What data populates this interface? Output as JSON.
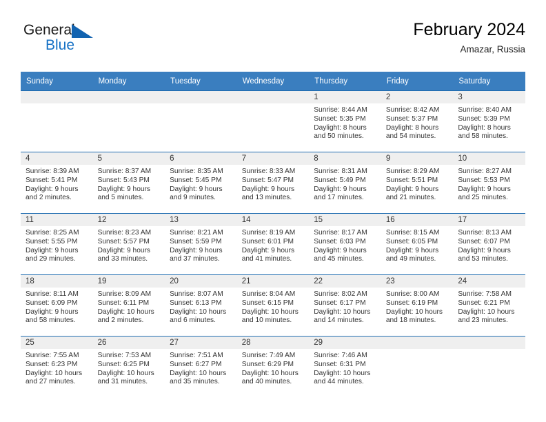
{
  "brand": {
    "word1": "General",
    "word2": "Blue",
    "accent_color": "#1671c5",
    "triangle_icon": "triangle-logo-icon"
  },
  "header": {
    "title": "February 2024",
    "subtitle": "Amazar, Russia"
  },
  "theme": {
    "header_row_bg": "#3a7ebf",
    "row_divider": "#1e6bb0",
    "daynum_band_bg": "#efefef",
    "text": "#333333"
  },
  "weekday_headers": [
    "Sunday",
    "Monday",
    "Tuesday",
    "Wednesday",
    "Thursday",
    "Friday",
    "Saturday"
  ],
  "weeks": [
    [
      {
        "day": "",
        "lines": []
      },
      {
        "day": "",
        "lines": []
      },
      {
        "day": "",
        "lines": []
      },
      {
        "day": "",
        "lines": []
      },
      {
        "day": "1",
        "lines": [
          "Sunrise: 8:44 AM",
          "Sunset: 5:35 PM",
          "Daylight: 8 hours",
          "and 50 minutes."
        ]
      },
      {
        "day": "2",
        "lines": [
          "Sunrise: 8:42 AM",
          "Sunset: 5:37 PM",
          "Daylight: 8 hours",
          "and 54 minutes."
        ]
      },
      {
        "day": "3",
        "lines": [
          "Sunrise: 8:40 AM",
          "Sunset: 5:39 PM",
          "Daylight: 8 hours",
          "and 58 minutes."
        ]
      }
    ],
    [
      {
        "day": "4",
        "lines": [
          "Sunrise: 8:39 AM",
          "Sunset: 5:41 PM",
          "Daylight: 9 hours",
          "and 2 minutes."
        ]
      },
      {
        "day": "5",
        "lines": [
          "Sunrise: 8:37 AM",
          "Sunset: 5:43 PM",
          "Daylight: 9 hours",
          "and 5 minutes."
        ]
      },
      {
        "day": "6",
        "lines": [
          "Sunrise: 8:35 AM",
          "Sunset: 5:45 PM",
          "Daylight: 9 hours",
          "and 9 minutes."
        ]
      },
      {
        "day": "7",
        "lines": [
          "Sunrise: 8:33 AM",
          "Sunset: 5:47 PM",
          "Daylight: 9 hours",
          "and 13 minutes."
        ]
      },
      {
        "day": "8",
        "lines": [
          "Sunrise: 8:31 AM",
          "Sunset: 5:49 PM",
          "Daylight: 9 hours",
          "and 17 minutes."
        ]
      },
      {
        "day": "9",
        "lines": [
          "Sunrise: 8:29 AM",
          "Sunset: 5:51 PM",
          "Daylight: 9 hours",
          "and 21 minutes."
        ]
      },
      {
        "day": "10",
        "lines": [
          "Sunrise: 8:27 AM",
          "Sunset: 5:53 PM",
          "Daylight: 9 hours",
          "and 25 minutes."
        ]
      }
    ],
    [
      {
        "day": "11",
        "lines": [
          "Sunrise: 8:25 AM",
          "Sunset: 5:55 PM",
          "Daylight: 9 hours",
          "and 29 minutes."
        ]
      },
      {
        "day": "12",
        "lines": [
          "Sunrise: 8:23 AM",
          "Sunset: 5:57 PM",
          "Daylight: 9 hours",
          "and 33 minutes."
        ]
      },
      {
        "day": "13",
        "lines": [
          "Sunrise: 8:21 AM",
          "Sunset: 5:59 PM",
          "Daylight: 9 hours",
          "and 37 minutes."
        ]
      },
      {
        "day": "14",
        "lines": [
          "Sunrise: 8:19 AM",
          "Sunset: 6:01 PM",
          "Daylight: 9 hours",
          "and 41 minutes."
        ]
      },
      {
        "day": "15",
        "lines": [
          "Sunrise: 8:17 AM",
          "Sunset: 6:03 PM",
          "Daylight: 9 hours",
          "and 45 minutes."
        ]
      },
      {
        "day": "16",
        "lines": [
          "Sunrise: 8:15 AM",
          "Sunset: 6:05 PM",
          "Daylight: 9 hours",
          "and 49 minutes."
        ]
      },
      {
        "day": "17",
        "lines": [
          "Sunrise: 8:13 AM",
          "Sunset: 6:07 PM",
          "Daylight: 9 hours",
          "and 53 minutes."
        ]
      }
    ],
    [
      {
        "day": "18",
        "lines": [
          "Sunrise: 8:11 AM",
          "Sunset: 6:09 PM",
          "Daylight: 9 hours",
          "and 58 minutes."
        ]
      },
      {
        "day": "19",
        "lines": [
          "Sunrise: 8:09 AM",
          "Sunset: 6:11 PM",
          "Daylight: 10 hours",
          "and 2 minutes."
        ]
      },
      {
        "day": "20",
        "lines": [
          "Sunrise: 8:07 AM",
          "Sunset: 6:13 PM",
          "Daylight: 10 hours",
          "and 6 minutes."
        ]
      },
      {
        "day": "21",
        "lines": [
          "Sunrise: 8:04 AM",
          "Sunset: 6:15 PM",
          "Daylight: 10 hours",
          "and 10 minutes."
        ]
      },
      {
        "day": "22",
        "lines": [
          "Sunrise: 8:02 AM",
          "Sunset: 6:17 PM",
          "Daylight: 10 hours",
          "and 14 minutes."
        ]
      },
      {
        "day": "23",
        "lines": [
          "Sunrise: 8:00 AM",
          "Sunset: 6:19 PM",
          "Daylight: 10 hours",
          "and 18 minutes."
        ]
      },
      {
        "day": "24",
        "lines": [
          "Sunrise: 7:58 AM",
          "Sunset: 6:21 PM",
          "Daylight: 10 hours",
          "and 23 minutes."
        ]
      }
    ],
    [
      {
        "day": "25",
        "lines": [
          "Sunrise: 7:55 AM",
          "Sunset: 6:23 PM",
          "Daylight: 10 hours",
          "and 27 minutes."
        ]
      },
      {
        "day": "26",
        "lines": [
          "Sunrise: 7:53 AM",
          "Sunset: 6:25 PM",
          "Daylight: 10 hours",
          "and 31 minutes."
        ]
      },
      {
        "day": "27",
        "lines": [
          "Sunrise: 7:51 AM",
          "Sunset: 6:27 PM",
          "Daylight: 10 hours",
          "and 35 minutes."
        ]
      },
      {
        "day": "28",
        "lines": [
          "Sunrise: 7:49 AM",
          "Sunset: 6:29 PM",
          "Daylight: 10 hours",
          "and 40 minutes."
        ]
      },
      {
        "day": "29",
        "lines": [
          "Sunrise: 7:46 AM",
          "Sunset: 6:31 PM",
          "Daylight: 10 hours",
          "and 44 minutes."
        ]
      },
      {
        "day": "",
        "lines": []
      },
      {
        "day": "",
        "lines": []
      }
    ]
  ]
}
